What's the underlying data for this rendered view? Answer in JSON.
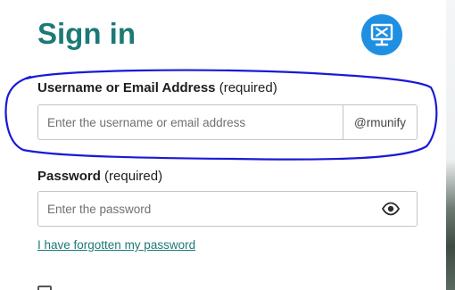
{
  "page": {
    "title": "Sign in"
  },
  "username": {
    "label": "Username or Email Address",
    "required": "(required)",
    "placeholder": "Enter the username or email address",
    "value": "",
    "domain_suffix": "@rmunify"
  },
  "password": {
    "label": "Password",
    "required": "(required)",
    "placeholder": "Enter the password",
    "value": ""
  },
  "links": {
    "forgot_password": "I have forgotten my password"
  },
  "icons": {
    "logo": "monitor-tools-icon",
    "password_toggle": "eye-icon"
  },
  "colors": {
    "heading": "#1c7a76",
    "link": "#1c7a76",
    "logo_background": "#1f8fe2",
    "annotation_ink": "#1a1ad6"
  }
}
